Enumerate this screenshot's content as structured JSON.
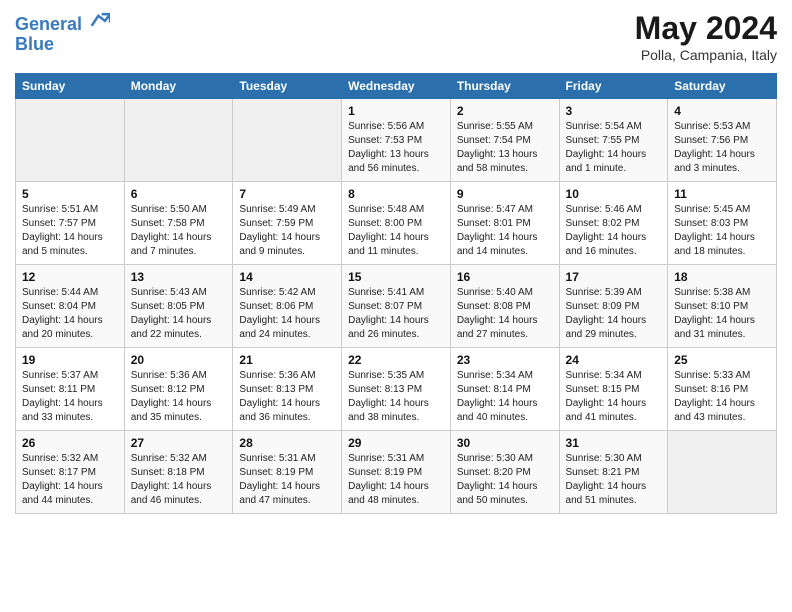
{
  "header": {
    "logo_line1": "General",
    "logo_line2": "Blue",
    "month": "May 2024",
    "location": "Polla, Campania, Italy"
  },
  "weekdays": [
    "Sunday",
    "Monday",
    "Tuesday",
    "Wednesday",
    "Thursday",
    "Friday",
    "Saturday"
  ],
  "weeks": [
    [
      {
        "day": "",
        "info": ""
      },
      {
        "day": "",
        "info": ""
      },
      {
        "day": "",
        "info": ""
      },
      {
        "day": "1",
        "info": "Sunrise: 5:56 AM\nSunset: 7:53 PM\nDaylight: 13 hours\nand 56 minutes."
      },
      {
        "day": "2",
        "info": "Sunrise: 5:55 AM\nSunset: 7:54 PM\nDaylight: 13 hours\nand 58 minutes."
      },
      {
        "day": "3",
        "info": "Sunrise: 5:54 AM\nSunset: 7:55 PM\nDaylight: 14 hours\nand 1 minute."
      },
      {
        "day": "4",
        "info": "Sunrise: 5:53 AM\nSunset: 7:56 PM\nDaylight: 14 hours\nand 3 minutes."
      }
    ],
    [
      {
        "day": "5",
        "info": "Sunrise: 5:51 AM\nSunset: 7:57 PM\nDaylight: 14 hours\nand 5 minutes."
      },
      {
        "day": "6",
        "info": "Sunrise: 5:50 AM\nSunset: 7:58 PM\nDaylight: 14 hours\nand 7 minutes."
      },
      {
        "day": "7",
        "info": "Sunrise: 5:49 AM\nSunset: 7:59 PM\nDaylight: 14 hours\nand 9 minutes."
      },
      {
        "day": "8",
        "info": "Sunrise: 5:48 AM\nSunset: 8:00 PM\nDaylight: 14 hours\nand 11 minutes."
      },
      {
        "day": "9",
        "info": "Sunrise: 5:47 AM\nSunset: 8:01 PM\nDaylight: 14 hours\nand 14 minutes."
      },
      {
        "day": "10",
        "info": "Sunrise: 5:46 AM\nSunset: 8:02 PM\nDaylight: 14 hours\nand 16 minutes."
      },
      {
        "day": "11",
        "info": "Sunrise: 5:45 AM\nSunset: 8:03 PM\nDaylight: 14 hours\nand 18 minutes."
      }
    ],
    [
      {
        "day": "12",
        "info": "Sunrise: 5:44 AM\nSunset: 8:04 PM\nDaylight: 14 hours\nand 20 minutes."
      },
      {
        "day": "13",
        "info": "Sunrise: 5:43 AM\nSunset: 8:05 PM\nDaylight: 14 hours\nand 22 minutes."
      },
      {
        "day": "14",
        "info": "Sunrise: 5:42 AM\nSunset: 8:06 PM\nDaylight: 14 hours\nand 24 minutes."
      },
      {
        "day": "15",
        "info": "Sunrise: 5:41 AM\nSunset: 8:07 PM\nDaylight: 14 hours\nand 26 minutes."
      },
      {
        "day": "16",
        "info": "Sunrise: 5:40 AM\nSunset: 8:08 PM\nDaylight: 14 hours\nand 27 minutes."
      },
      {
        "day": "17",
        "info": "Sunrise: 5:39 AM\nSunset: 8:09 PM\nDaylight: 14 hours\nand 29 minutes."
      },
      {
        "day": "18",
        "info": "Sunrise: 5:38 AM\nSunset: 8:10 PM\nDaylight: 14 hours\nand 31 minutes."
      }
    ],
    [
      {
        "day": "19",
        "info": "Sunrise: 5:37 AM\nSunset: 8:11 PM\nDaylight: 14 hours\nand 33 minutes."
      },
      {
        "day": "20",
        "info": "Sunrise: 5:36 AM\nSunset: 8:12 PM\nDaylight: 14 hours\nand 35 minutes."
      },
      {
        "day": "21",
        "info": "Sunrise: 5:36 AM\nSunset: 8:13 PM\nDaylight: 14 hours\nand 36 minutes."
      },
      {
        "day": "22",
        "info": "Sunrise: 5:35 AM\nSunset: 8:13 PM\nDaylight: 14 hours\nand 38 minutes."
      },
      {
        "day": "23",
        "info": "Sunrise: 5:34 AM\nSunset: 8:14 PM\nDaylight: 14 hours\nand 40 minutes."
      },
      {
        "day": "24",
        "info": "Sunrise: 5:34 AM\nSunset: 8:15 PM\nDaylight: 14 hours\nand 41 minutes."
      },
      {
        "day": "25",
        "info": "Sunrise: 5:33 AM\nSunset: 8:16 PM\nDaylight: 14 hours\nand 43 minutes."
      }
    ],
    [
      {
        "day": "26",
        "info": "Sunrise: 5:32 AM\nSunset: 8:17 PM\nDaylight: 14 hours\nand 44 minutes."
      },
      {
        "day": "27",
        "info": "Sunrise: 5:32 AM\nSunset: 8:18 PM\nDaylight: 14 hours\nand 46 minutes."
      },
      {
        "day": "28",
        "info": "Sunrise: 5:31 AM\nSunset: 8:19 PM\nDaylight: 14 hours\nand 47 minutes."
      },
      {
        "day": "29",
        "info": "Sunrise: 5:31 AM\nSunset: 8:19 PM\nDaylight: 14 hours\nand 48 minutes."
      },
      {
        "day": "30",
        "info": "Sunrise: 5:30 AM\nSunset: 8:20 PM\nDaylight: 14 hours\nand 50 minutes."
      },
      {
        "day": "31",
        "info": "Sunrise: 5:30 AM\nSunset: 8:21 PM\nDaylight: 14 hours\nand 51 minutes."
      },
      {
        "day": "",
        "info": ""
      }
    ]
  ]
}
